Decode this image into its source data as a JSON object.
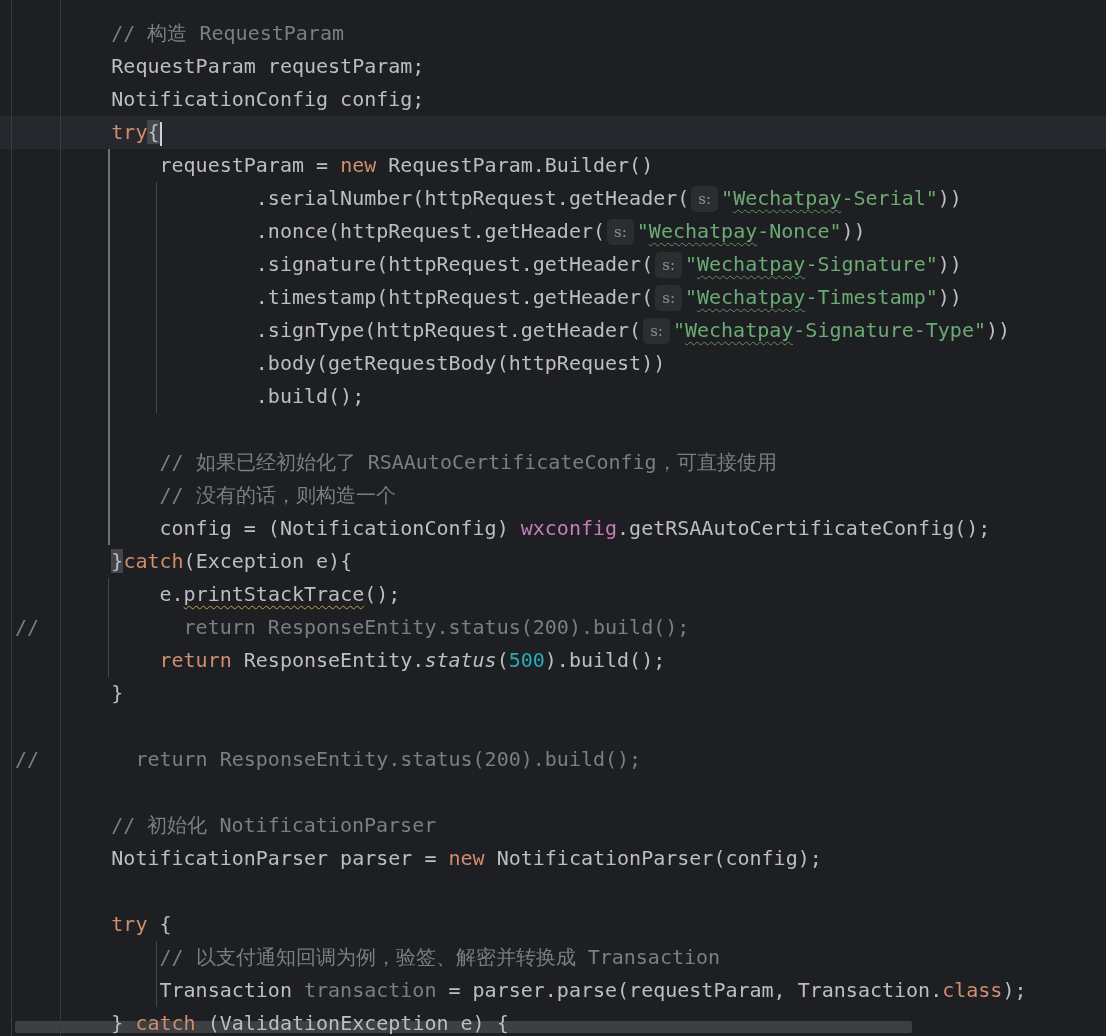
{
  "editor": {
    "lines": [
      {
        "kind": "code",
        "segments": [
          {
            "kind": "code",
            "tokens": [
              {
                "text": "        // 构造 RequestParam",
                "kind": "comment"
              }
            ]
          }
        ]
      },
      {
        "kind": "code",
        "segments": [
          {
            "kind": "code",
            "tokens": [
              {
                "text": "        RequestParam requestParam;",
                "kind": "plain"
              }
            ]
          }
        ]
      },
      {
        "kind": "code",
        "segments": [
          {
            "kind": "code",
            "tokens": [
              {
                "text": "        NotificationConfig config;",
                "kind": "plain"
              }
            ]
          }
        ]
      },
      {
        "kind": "code",
        "current": true,
        "segments": [
          {
            "kind": "code",
            "tokens": [
              {
                "text": "        try",
                "kind": "keyword"
              },
              {
                "text": "{",
                "kind": "plain",
                "bracket_match": true,
                "caret": true
              }
            ]
          }
        ]
      },
      {
        "kind": "code",
        "segments": [
          {
            "kind": "code",
            "tokens": [
              {
                "text": "            requestParam = ",
                "kind": "plain"
              },
              {
                "text": "new",
                "kind": "keyword"
              },
              {
                "text": " RequestParam.Builder()",
                "kind": "plain"
              }
            ]
          }
        ]
      },
      {
        "kind": "code",
        "segments": [
          {
            "kind": "code",
            "tokens": [
              {
                "text": "                    .serialNumber(httpRequest.getHeader(",
                "kind": "plain"
              }
            ]
          },
          {
            "kind": "hint",
            "text": "s:"
          },
          {
            "kind": "code",
            "tokens": [
              {
                "text": "\"",
                "kind": "string"
              },
              {
                "text": "Wechatpay",
                "kind": "string",
                "misspelled": true
              },
              {
                "text": "-Serial\"",
                "kind": "string"
              },
              {
                "text": "))",
                "kind": "plain"
              }
            ]
          }
        ]
      },
      {
        "kind": "code",
        "segments": [
          {
            "kind": "code",
            "tokens": [
              {
                "text": "                    .nonce(httpRequest.getHeader(",
                "kind": "plain"
              }
            ]
          },
          {
            "kind": "hint",
            "text": "s:"
          },
          {
            "kind": "code",
            "tokens": [
              {
                "text": "\"",
                "kind": "string"
              },
              {
                "text": "Wechatpay",
                "kind": "string",
                "misspelled": true
              },
              {
                "text": "-Nonce\"",
                "kind": "string"
              },
              {
                "text": "))",
                "kind": "plain"
              }
            ]
          }
        ]
      },
      {
        "kind": "code",
        "segments": [
          {
            "kind": "code",
            "tokens": [
              {
                "text": "                    .signature(httpRequest.getHeader(",
                "kind": "plain"
              }
            ]
          },
          {
            "kind": "hint",
            "text": "s:"
          },
          {
            "kind": "code",
            "tokens": [
              {
                "text": "\"",
                "kind": "string"
              },
              {
                "text": "Wechatpay",
                "kind": "string",
                "misspelled": true
              },
              {
                "text": "-Signature\"",
                "kind": "string"
              },
              {
                "text": "))",
                "kind": "plain"
              }
            ]
          }
        ]
      },
      {
        "kind": "code",
        "segments": [
          {
            "kind": "code",
            "tokens": [
              {
                "text": "                    .timestamp(httpRequest.getHeader(",
                "kind": "plain"
              }
            ]
          },
          {
            "kind": "hint",
            "text": "s:"
          },
          {
            "kind": "code",
            "tokens": [
              {
                "text": "\"",
                "kind": "string"
              },
              {
                "text": "Wechatpay",
                "kind": "string",
                "misspelled": true
              },
              {
                "text": "-Timestamp\"",
                "kind": "string"
              },
              {
                "text": "))",
                "kind": "plain"
              }
            ]
          }
        ]
      },
      {
        "kind": "code",
        "segments": [
          {
            "kind": "code",
            "tokens": [
              {
                "text": "                    .signType(httpRequest.getHeader(",
                "kind": "plain"
              }
            ]
          },
          {
            "kind": "hint",
            "text": "s:"
          },
          {
            "kind": "code",
            "tokens": [
              {
                "text": "\"",
                "kind": "string"
              },
              {
                "text": "Wechatpay",
                "kind": "string",
                "misspelled": true
              },
              {
                "text": "-Signature-Type\"",
                "kind": "string"
              },
              {
                "text": "))",
                "kind": "plain"
              }
            ]
          }
        ]
      },
      {
        "kind": "code",
        "segments": [
          {
            "kind": "code",
            "tokens": [
              {
                "text": "                    .body(getRequestBody(httpRequest))",
                "kind": "plain"
              }
            ]
          }
        ]
      },
      {
        "kind": "code",
        "segments": [
          {
            "kind": "code",
            "tokens": [
              {
                "text": "                    .build();",
                "kind": "plain"
              }
            ]
          }
        ]
      },
      {
        "kind": "blank"
      },
      {
        "kind": "code",
        "segments": [
          {
            "kind": "code",
            "tokens": [
              {
                "text": "            // 如果已经初始化了 RSAAutoCertificateConfig，可直接使用",
                "kind": "comment"
              }
            ]
          }
        ]
      },
      {
        "kind": "code",
        "segments": [
          {
            "kind": "code",
            "tokens": [
              {
                "text": "            // 没有的话，则构造一个",
                "kind": "comment"
              }
            ]
          }
        ]
      },
      {
        "kind": "code",
        "segments": [
          {
            "kind": "code",
            "tokens": [
              {
                "text": "            config = (NotificationConfig) ",
                "kind": "plain"
              },
              {
                "text": "wxconfig",
                "kind": "field"
              },
              {
                "text": ".getRSAAutoCertificateConfig();",
                "kind": "plain"
              }
            ]
          }
        ]
      },
      {
        "kind": "code",
        "segments": [
          {
            "kind": "code",
            "tokens": [
              {
                "text": "        }",
                "kind": "plain",
                "bracket_match": true
              },
              {
                "text": "catch",
                "kind": "keyword"
              },
              {
                "text": "(Exception e){",
                "kind": "plain"
              }
            ]
          }
        ]
      },
      {
        "kind": "code",
        "segments": [
          {
            "kind": "code",
            "tokens": [
              {
                "text": "            e.",
                "kind": "plain"
              },
              {
                "text": "printStackTrace",
                "kind": "plain",
                "warning": true
              },
              {
                "text": "();",
                "kind": "plain"
              }
            ]
          }
        ]
      },
      {
        "kind": "code",
        "segments": [
          {
            "kind": "code",
            "tokens": [
              {
                "text": "//            return ResponseEntity.status(200).build();",
                "kind": "comment"
              }
            ]
          }
        ]
      },
      {
        "kind": "code",
        "segments": [
          {
            "kind": "code",
            "tokens": [
              {
                "text": "            return",
                "kind": "keyword"
              },
              {
                "text": " ResponseEntity.",
                "kind": "plain"
              },
              {
                "text": "status",
                "kind": "static"
              },
              {
                "text": "(",
                "kind": "plain"
              },
              {
                "text": "500",
                "kind": "number"
              },
              {
                "text": ").build();",
                "kind": "plain"
              }
            ]
          }
        ]
      },
      {
        "kind": "code",
        "segments": [
          {
            "kind": "code",
            "tokens": [
              {
                "text": "        }",
                "kind": "plain"
              }
            ]
          }
        ]
      },
      {
        "kind": "blank"
      },
      {
        "kind": "code",
        "segments": [
          {
            "kind": "code",
            "tokens": [
              {
                "text": "//        return ResponseEntity.status(200).build();",
                "kind": "comment"
              }
            ]
          }
        ]
      },
      {
        "kind": "blank"
      },
      {
        "kind": "code",
        "segments": [
          {
            "kind": "code",
            "tokens": [
              {
                "text": "        // 初始化 NotificationParser",
                "kind": "comment"
              }
            ]
          }
        ]
      },
      {
        "kind": "code",
        "segments": [
          {
            "kind": "code",
            "tokens": [
              {
                "text": "        NotificationParser parser = ",
                "kind": "plain"
              },
              {
                "text": "new",
                "kind": "keyword"
              },
              {
                "text": " NotificationParser(config);",
                "kind": "plain"
              }
            ]
          }
        ]
      },
      {
        "kind": "blank"
      },
      {
        "kind": "code",
        "segments": [
          {
            "kind": "code",
            "tokens": [
              {
                "text": "        try",
                "kind": "keyword"
              },
              {
                "text": " {",
                "kind": "plain"
              }
            ]
          }
        ]
      },
      {
        "kind": "code",
        "segments": [
          {
            "kind": "code",
            "tokens": [
              {
                "text": "            // 以支付通知回调为例，验签、解密并转换成 Transaction",
                "kind": "comment"
              }
            ]
          }
        ]
      },
      {
        "kind": "code",
        "segments": [
          {
            "kind": "code",
            "tokens": [
              {
                "text": "            Transaction ",
                "kind": "plain"
              },
              {
                "text": "transaction",
                "kind": "unused"
              },
              {
                "text": " = parser.parse(requestParam, Transaction.",
                "kind": "plain"
              },
              {
                "text": "class",
                "kind": "keyword"
              },
              {
                "text": ");",
                "kind": "plain"
              }
            ]
          }
        ]
      },
      {
        "kind": "code",
        "segments": [
          {
            "kind": "code",
            "tokens": [
              {
                "text": "        } ",
                "kind": "plain"
              },
              {
                "text": "catch",
                "kind": "keyword"
              },
              {
                "text": " (ValidationException e) {",
                "kind": "plain"
              }
            ]
          }
        ]
      }
    ]
  }
}
